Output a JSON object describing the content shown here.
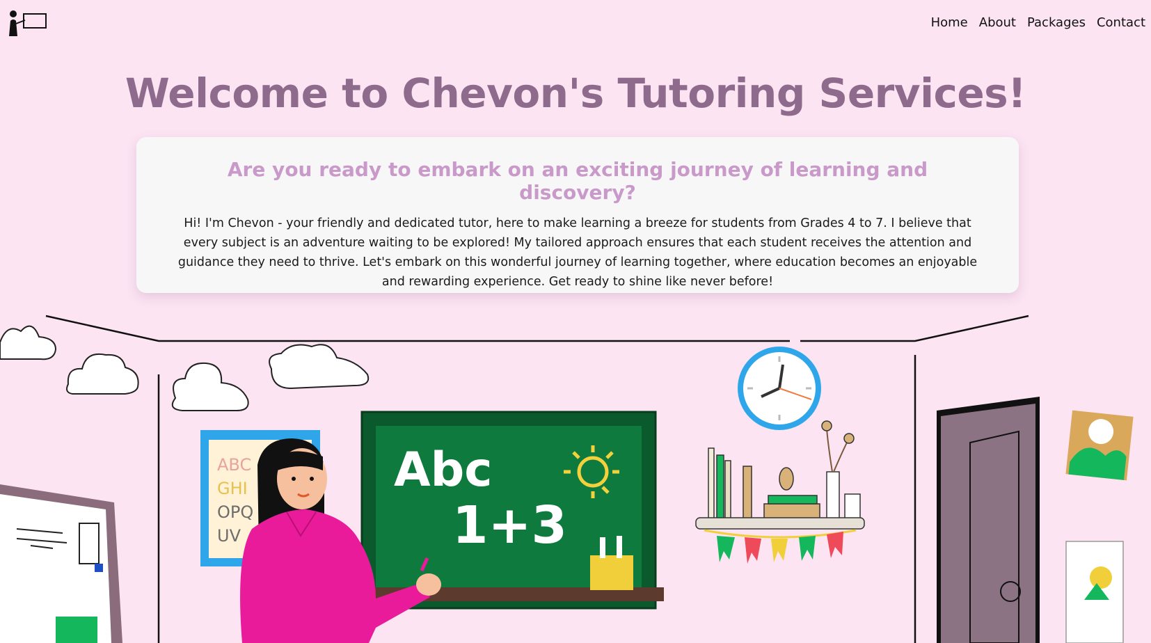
{
  "nav": {
    "logo_icon": "teacher-board-icon",
    "links": [
      "Home",
      "About",
      "Packages",
      "Contact"
    ]
  },
  "hero": {
    "title": "Welcome to Chevon's Tutoring Services!"
  },
  "intro": {
    "heading": "Are you ready to embark on an exciting journey of learning and discovery?",
    "body": "Hi! I'm Chevon - your friendly and dedicated tutor, here to make learning a breeze for students from Grades 4 to 7. I believe that every subject is an adventure waiting to be explored! My tailored approach ensures that each student receives the attention and guidance they need to thrive. Let's embark on this wonderful journey of learning together, where education becomes an enjoyable and rewarding experience. Get ready to shine like never before!"
  },
  "illustration": {
    "chalkboard_line1": "Abc",
    "chalkboard_line2": "1+3",
    "abc_poster_letters": [
      "ABC",
      "GHI",
      "OPQ",
      "UV"
    ]
  },
  "colors": {
    "background": "#fce4f3",
    "title": "#8e6b8c",
    "heading": "#c99ac9",
    "card": "#f8f7f8",
    "chalkboard": "#0f7a3d",
    "teacher_shirt": "#ea1b9a"
  }
}
